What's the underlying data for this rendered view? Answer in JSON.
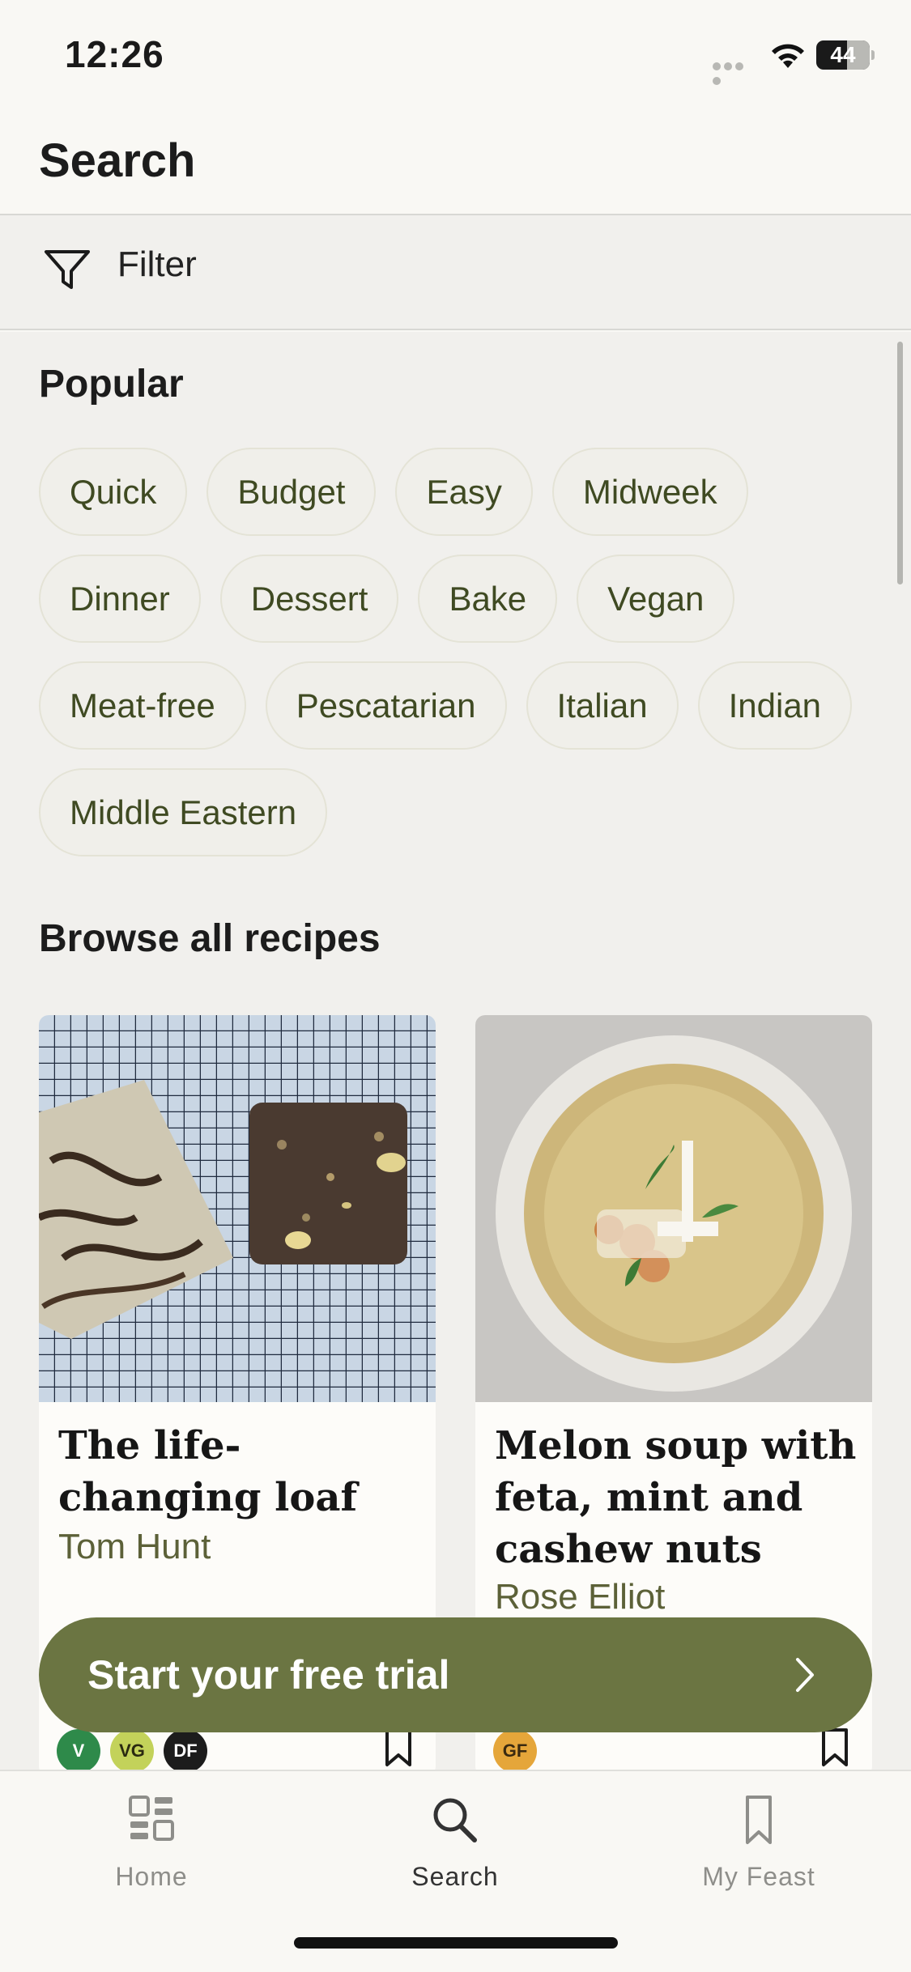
{
  "status_bar": {
    "time": "12:26",
    "battery": "44"
  },
  "header": {
    "title": "Search"
  },
  "filter": {
    "label": "Filter"
  },
  "popular": {
    "title": "Popular",
    "chips": [
      "Quick",
      "Budget",
      "Easy",
      "Midweek",
      "Dinner",
      "Dessert",
      "Bake",
      "Vegan",
      "Meat-free",
      "Pescatarian",
      "Italian",
      "Indian",
      "Middle Eastern"
    ]
  },
  "browse": {
    "title": "Browse all recipes",
    "recipes": [
      {
        "title": "The life-changing loaf",
        "author": "Tom Hunt",
        "badges": [
          "V",
          "VG",
          "DF"
        ]
      },
      {
        "title": "Melon soup with feta, mint and cashew nuts",
        "author": "Rose Elliot",
        "badges": [
          "GF"
        ]
      }
    ]
  },
  "cta": {
    "label": "Start your free trial"
  },
  "tabs": [
    {
      "label": "Home",
      "icon": "home-grid-icon",
      "active": false
    },
    {
      "label": "Search",
      "icon": "search-icon",
      "active": true
    },
    {
      "label": "My Feast",
      "icon": "bookmark-icon",
      "active": false
    }
  ],
  "colors": {
    "accent": "#6b7542",
    "chip_text": "#3f4a22",
    "background": "#f1f0ed",
    "badge_v": "#2e8a4a",
    "badge_vg": "#c3d25a",
    "badge_df": "#1c1c1c",
    "badge_gf": "#e5a63a"
  }
}
